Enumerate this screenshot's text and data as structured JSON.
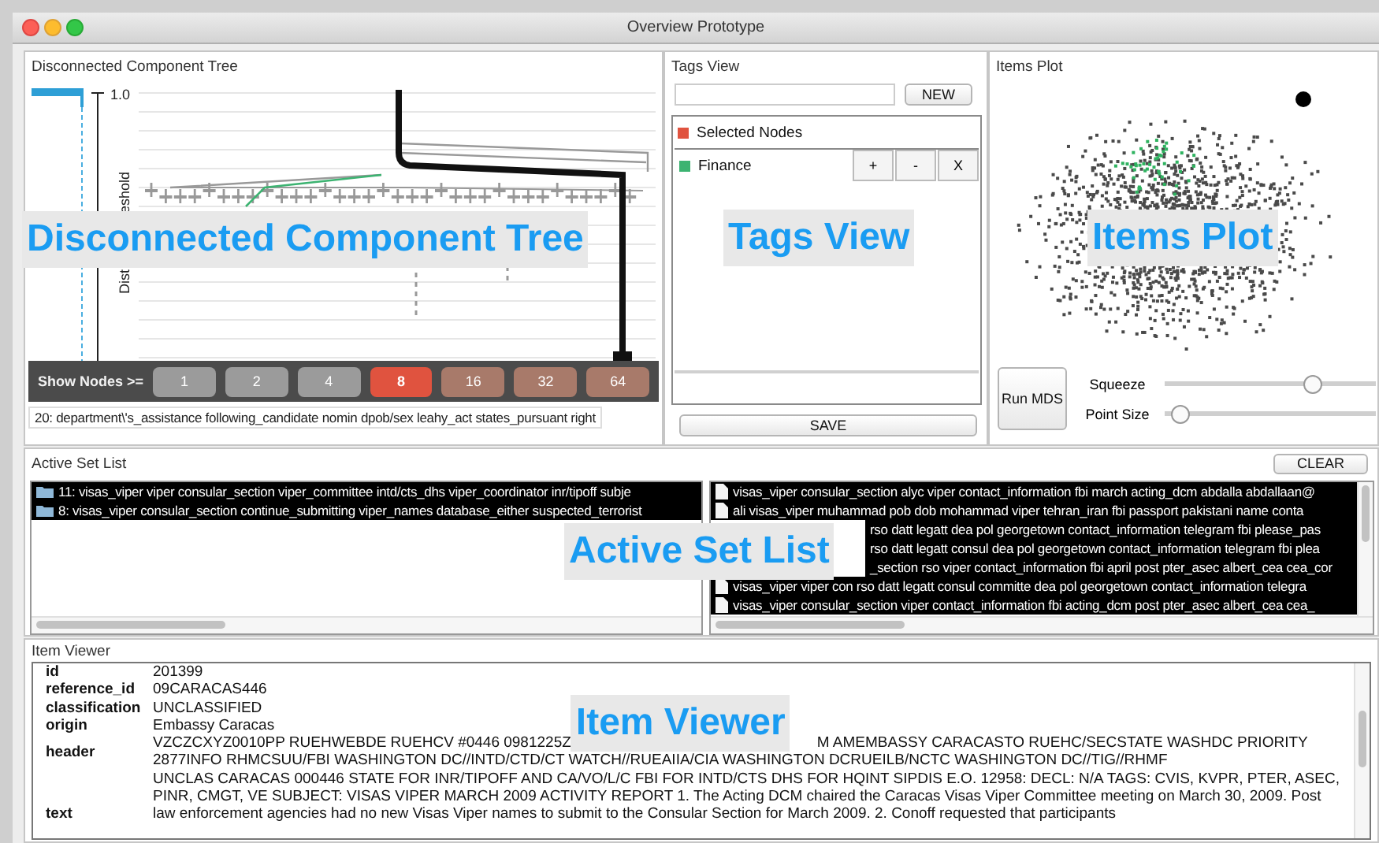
{
  "window": {
    "title": "Overview Prototype"
  },
  "tree_panel": {
    "title": "Disconnected Component Tree",
    "tick_label": "1.0",
    "axis_label_parts": [
      "eshold",
      "Dist"
    ],
    "show_nodes": {
      "label": "Show Nodes >=",
      "buttons": [
        {
          "label": "1",
          "color": "#9b9b9b",
          "selected": false
        },
        {
          "label": "2",
          "color": "#9b9b9b",
          "selected": false
        },
        {
          "label": "4",
          "color": "#9b9b9b",
          "selected": false
        },
        {
          "label": "8",
          "color": "#e0533f",
          "selected": true
        },
        {
          "label": "16",
          "color": "#a87a6a",
          "selected": false
        },
        {
          "label": "32",
          "color": "#a87a6a",
          "selected": false
        },
        {
          "label": "64",
          "color": "#a87a6a",
          "selected": false
        }
      ]
    },
    "status": "20: department\\'s_assistance following_candidate nomin dpob/sex leahy_act states_pursuant right",
    "overlay_label": "Disconnected Component Tree"
  },
  "tags_view": {
    "title": "Tags View",
    "new_button": "NEW",
    "tags": [
      {
        "kind": "selection",
        "label": "Selected Nodes",
        "color": "#e0533f"
      },
      {
        "kind": "tag",
        "label": "Finance",
        "color": "#3cb371",
        "buttons": [
          "+",
          "-",
          "X"
        ]
      }
    ],
    "save_button": "SAVE",
    "overlay_label": "Tags View"
  },
  "items_plot": {
    "title": "Items Plot",
    "run_button": "Run MDS",
    "sliders": [
      {
        "label": "Squeeze",
        "level": 0.72
      },
      {
        "label": "Point Size",
        "level": 0.03
      }
    ],
    "overlay_label": "Items Plot"
  },
  "active_set_list": {
    "title": "Active Set List",
    "clear_button": "CLEAR",
    "sets": [
      {
        "text": "11: visas_viper viper consular_section viper_committee intd/cts_dhs viper_coordinator inr/tipoff subje",
        "selected": true
      },
      {
        "text": "8: visas_viper consular_section continue_submitting viper_names database_either suspected_terrorist",
        "selected": true
      }
    ],
    "items": [
      {
        "text": "visas_viper consular_section alyc viper contact_information fbi march acting_dcm abdalla abdallaan@",
        "selected": true,
        "covered": false
      },
      {
        "text": "ali visas_viper muhammad pob dob mohammad viper tehran_iran fbi passport pakistani name conta",
        "selected": true,
        "covered": false
      },
      {
        "text": "rso datt legatt dea pol georgetown contact_information telegram fbi please_pas",
        "selected": true,
        "covered": true
      },
      {
        "text": "rso datt legatt consul dea pol georgetown contact_information telegram fbi plea",
        "selected": true,
        "covered": true
      },
      {
        "text": "_section rso viper contact_information fbi april post pter_asec albert_cea cea_cor",
        "selected": true,
        "covered": true
      },
      {
        "text": "visas_viper viper con rso datt legatt consul committe dea pol georgetown contact_information telegra",
        "selected": true,
        "covered": false
      },
      {
        "text": "visas_viper consular_section viper contact_information fbi acting_dcm post pter_asec albert_cea cea_",
        "selected": true,
        "covered": false
      }
    ],
    "overlay_label": "Active Set List"
  },
  "item_viewer": {
    "title": "Item Viewer",
    "fields": [
      {
        "key": "id",
        "kind": "lines",
        "lines": [
          [
            "201399"
          ]
        ]
      },
      {
        "key": "reference_id",
        "kind": "lines",
        "lines": [
          [
            "09CARACAS446"
          ]
        ]
      },
      {
        "key": "classification",
        "kind": "lines",
        "lines": [
          [
            "UNCLASSIFIED"
          ]
        ]
      },
      {
        "key": "origin",
        "kind": "lines",
        "lines": [
          [
            "Embassy Caracas"
          ]
        ]
      },
      {
        "key": "header",
        "kind": "lines",
        "lines": [
          [
            "VZCZCXYZ0010PP RUEHWEBDE RUEHCV #0446 0981225Z",
            "M AMEMBASSY CARACASTO RUEHC/SECSTATE WASHDC PRIORITY"
          ],
          [
            "2877INFO RHMCSUU/FBI WASHINGTON DC//INTD/CTD/CT WATCH//RUEAIIA/CIA WASHINGTON DCRUEILB/NCTC WASHINGTON DC//TIG//RHMF"
          ]
        ]
      },
      {
        "key": "text",
        "kind": "paragraph",
        "value": "UNCLAS CARACAS 000446 STATE FOR INR/TIPOFF AND CA/VO/L/C FBI FOR INTD/CTS DHS FOR HQINT SIPDIS E.O. 12958: DECL: N/A TAGS: CVIS, KVPR, PTER, ASEC, PINR, CMGT, VE SUBJECT: VISAS VIPER MARCH 2009 ACTIVITY REPORT 1. The Acting DCM chaired the Caracas Visas Viper Committee meeting on March 30, 2009. Post law enforcement agencies had no new Visas Viper names to submit to the Consular Section for March 2009. 2. Conoff requested that participants"
      }
    ],
    "overlay_label": "Item Viewer"
  }
}
